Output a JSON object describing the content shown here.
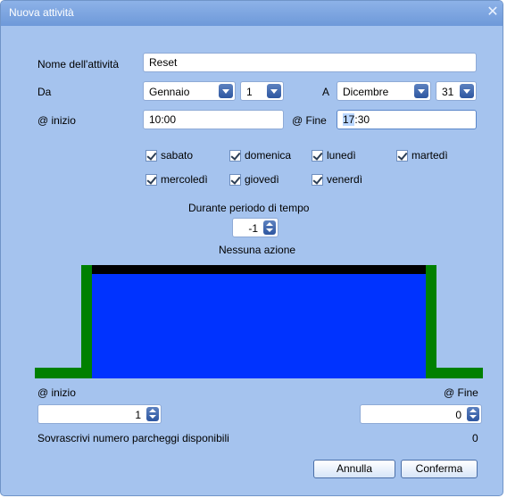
{
  "dialog": {
    "title": "Nuova attività",
    "close_glyph": "✕"
  },
  "form": {
    "name_label": "Nome dell'attività",
    "name_value": "Reset",
    "from_label": "Da",
    "from_month": "Gennaio",
    "from_day": "1",
    "to_label": "A",
    "to_month": "Dicembre",
    "to_day": "31",
    "start_label": "@ inizio",
    "start_value": "10:00",
    "end_label": "@ Fine",
    "end_value_selected": "17",
    "end_value_rest": ":30"
  },
  "days": [
    {
      "label": "sabato",
      "checked": true
    },
    {
      "label": "domenica",
      "checked": true
    },
    {
      "label": "lunedì",
      "checked": true
    },
    {
      "label": "martedì",
      "checked": true
    },
    {
      "label": "mercoledì",
      "checked": true
    },
    {
      "label": "giovedì",
      "checked": true
    },
    {
      "label": "venerdì",
      "checked": true
    }
  ],
  "period": {
    "label": "Durante periodo di tempo",
    "value": "-1",
    "action_label": "Nessuna azione"
  },
  "diagram_colors": {
    "ground": "#008000",
    "fill": "#0033ff",
    "top_bar": "#000000"
  },
  "bottom": {
    "start_label": "@ inizio",
    "start_value": "1",
    "end_label": "@ Fine",
    "end_value": "0",
    "override_label": "Sovrascrivi numero parcheggi disponibili",
    "override_value": "0"
  },
  "buttons": {
    "cancel": "Annulla",
    "confirm": "Conferma"
  }
}
